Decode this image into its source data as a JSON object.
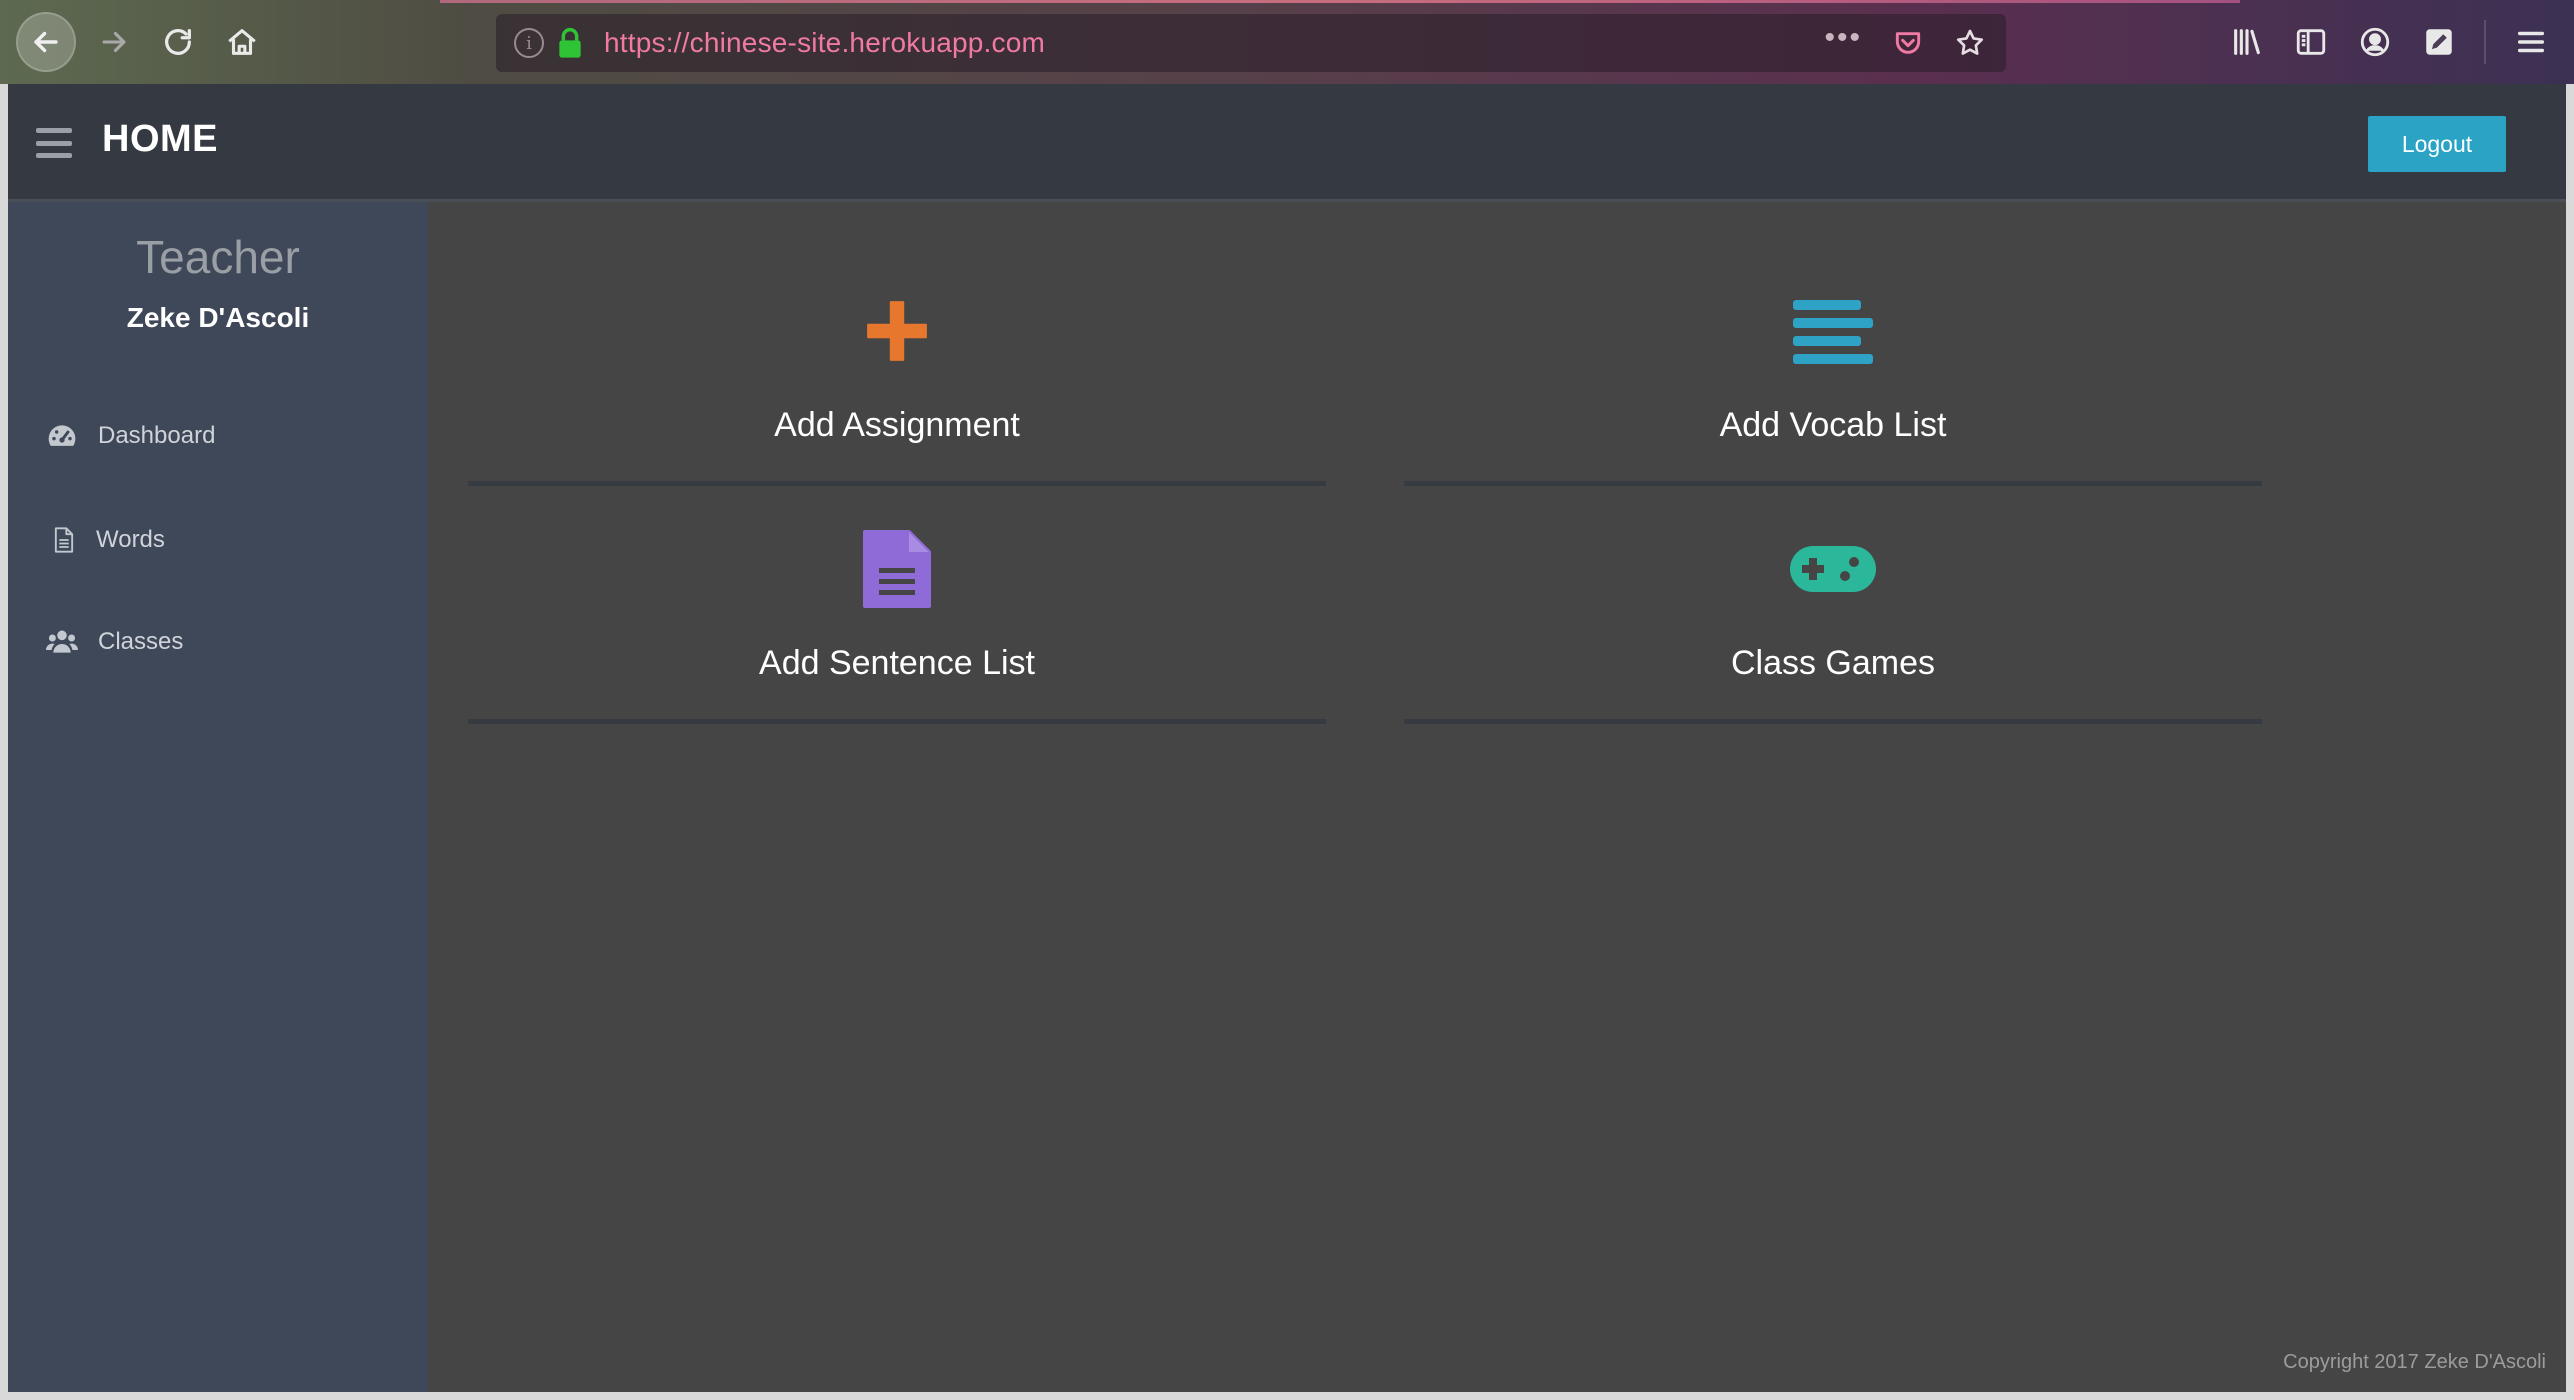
{
  "browser": {
    "url": "https://chinese-site.herokuapp.com",
    "url_more_glyph": "•••"
  },
  "header": {
    "title": "HOME",
    "logout_label": "Logout"
  },
  "sidebar": {
    "role": "Teacher",
    "user_name": "Zeke D'Ascoli",
    "items": [
      {
        "label": "Dashboard",
        "icon": "dashboard-icon"
      },
      {
        "label": "Words",
        "icon": "document-icon"
      },
      {
        "label": "Classes",
        "icon": "users-icon"
      }
    ]
  },
  "tiles": [
    {
      "label": "Add Assignment",
      "icon": "plus-icon",
      "color": "#e8772e"
    },
    {
      "label": "Add Vocab List",
      "icon": "align-lines-icon",
      "color": "#2ea3c6"
    },
    {
      "label": "Add Sentence List",
      "icon": "file-text-icon",
      "color": "#8f6bd8"
    },
    {
      "label": "Class Games",
      "icon": "gamepad-icon",
      "color": "#2bb79a"
    }
  ],
  "footer": {
    "copyright": "Copyright 2017 Zeke D'Ascoli"
  },
  "colors": {
    "accent": "#2aa3c4",
    "url_text": "#f07aa3",
    "sidebar_bg": "#3e4858",
    "content_bg": "#454545"
  }
}
